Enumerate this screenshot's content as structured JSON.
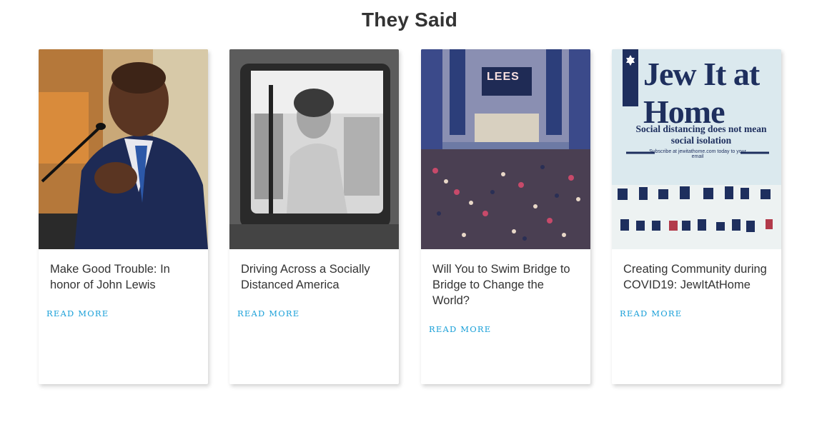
{
  "section": {
    "title": "They Said"
  },
  "cards": [
    {
      "title": "Make Good Trouble: In honor of John Lewis",
      "read_more": "READ MORE",
      "image": "speaker-at-podium-photo"
    },
    {
      "title": "Driving Across a Socially Distanced America",
      "read_more": "READ MORE",
      "image": "man-in-van-window-photo"
    },
    {
      "title": "Will You to Swim Bridge to Bridge to Change the World?",
      "read_more": "READ MORE",
      "image": "congregation-in-sanctuary-photo",
      "image_text": "LEES"
    },
    {
      "title": "Creating Community during COVID19: JewItAtHome",
      "read_more": "READ MORE",
      "image": "jew-it-at-home-banner",
      "banner": {
        "headline": "Jew It at Home",
        "subline": "Social distancing does not mean social isolation",
        "small": "Subscribe at jewitathome.com today to your email"
      }
    }
  ],
  "colors": {
    "link": "#1aa0d8",
    "title": "#333333",
    "banner_navy": "#1e2f5e"
  }
}
